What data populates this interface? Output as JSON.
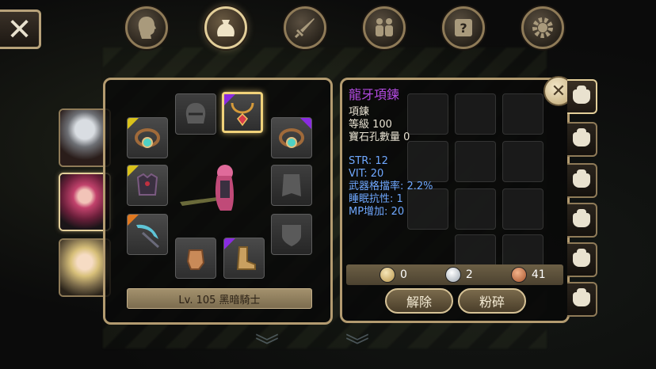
{
  "top_tabs": [
    {
      "name": "profile",
      "icon": "head-icon",
      "glyph": "☻",
      "active": false
    },
    {
      "name": "bag",
      "icon": "bag-icon",
      "glyph": "♜",
      "active": true
    },
    {
      "name": "skills",
      "icon": "sword-icon",
      "glyph": "⚔",
      "active": false
    },
    {
      "name": "party",
      "icon": "people-icon",
      "glyph": "♟",
      "active": false
    },
    {
      "name": "quest",
      "icon": "scroll-icon",
      "glyph": "?",
      "active": false
    },
    {
      "name": "settings",
      "icon": "gear-icon",
      "glyph": "⚙",
      "active": false
    }
  ],
  "close_glyph": "✕",
  "equip": {
    "level_text": "Lv. 105 黑暗騎士"
  },
  "item": {
    "name": "龍牙項鍊",
    "type": "項鍊",
    "level": "等級 100",
    "gem_slots": "寶石孔數量 0",
    "stats": [
      "STR: 12",
      "VIT: 20",
      "武器格擋率: 2.2%",
      "睡眠抗性: 1",
      "MP增加: 20"
    ]
  },
  "currency": {
    "gold": "0",
    "silver": "2",
    "copper": "41"
  },
  "actions": {
    "unequip": "解除",
    "shatter": "粉碎"
  },
  "colors": {
    "item_name": "#b24ae0",
    "stat_text": "#6fa8ff",
    "frame_gold": "#b39b70",
    "rarity_yellow": "#d9c21a",
    "rarity_purple": "#8a2be2",
    "rarity_orange": "#e07820"
  }
}
